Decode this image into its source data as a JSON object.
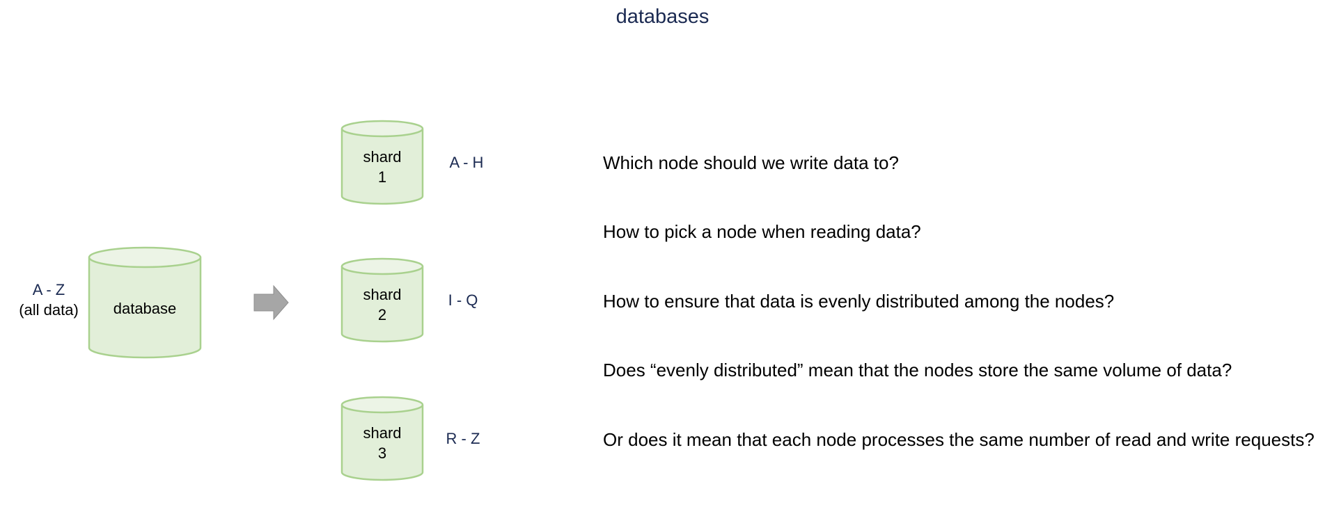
{
  "title": "databases",
  "source": {
    "range": "A - Z",
    "note": "(all data)",
    "label": "database"
  },
  "shards": [
    {
      "label_line1": "shard",
      "label_line2": "1",
      "range": "A - H"
    },
    {
      "label_line1": "shard",
      "label_line2": "2",
      "range": "I - Q"
    },
    {
      "label_line1": "shard",
      "label_line2": "3",
      "range": "R - Z"
    }
  ],
  "questions": [
    "Which node should we write data to?",
    "How to pick a node when reading data?",
    "How to ensure that data is evenly distributed among the nodes?",
    "Does “evenly distributed” mean that the nodes store the same volume of data?",
    "Or does it mean that each node processes the same number of read and write requests?"
  ],
  "colors": {
    "cylinder_fill": "#e2efd9",
    "cylinder_stroke": "#a9d18e",
    "arrow": "#a6a6a6",
    "accent_text": "#1b2a52"
  }
}
